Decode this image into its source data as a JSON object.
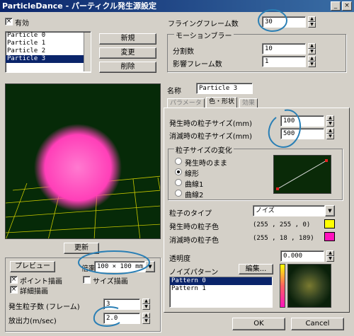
{
  "window": {
    "title": "ParticleDance - パーティクル発生源設定",
    "close_glyph": "×",
    "min_glyph": "_"
  },
  "enable_label": "有効",
  "particles": [
    "Particle 0",
    "Particle 1",
    "Particle 2",
    "Particle 3"
  ],
  "selected_particle_index": 3,
  "buttons": {
    "new": "新規",
    "change": "変更",
    "delete": "削除",
    "update": "更新",
    "preview": "プレビュー",
    "edit": "編集...",
    "ok": "OK",
    "cancel": "Cancel"
  },
  "flying_frames": {
    "label": "フライングフレーム数",
    "value": "30"
  },
  "motion_blur": {
    "title": "モーションブラー",
    "divisions_label": "分割数",
    "divisions_value": "10",
    "affect_frames_label": "影響フレーム数",
    "affect_frames_value": "1"
  },
  "name": {
    "label": "名称",
    "value": "Particle 3"
  },
  "tabs": [
    "パラメータ",
    "色・形状",
    "効果"
  ],
  "active_tab": 1,
  "size_birth": {
    "label": "発生時の粒子サイズ(mm)",
    "value": "100"
  },
  "size_death": {
    "label": "消滅時の粒子サイズ(mm)",
    "value": "500"
  },
  "size_change": {
    "title": "粒子サイズの変化",
    "options": [
      "発生時のまま",
      "線形",
      "曲線1",
      "曲線2"
    ],
    "selected": 1
  },
  "particle_type": {
    "label": "粒子のタイプ",
    "value": "ノイズ"
  },
  "color_birth": {
    "label": "発生時の粒子色",
    "value": "(255 , 255 , 0)",
    "swatch": "#ffff00"
  },
  "color_death": {
    "label": "消滅時の粒子色",
    "value": "(255 , 18 , 189)",
    "swatch": "#ff12bd"
  },
  "opacity": {
    "label": "透明度",
    "value": "0.000"
  },
  "noise_pattern": {
    "label": "ノイズパターン",
    "items": [
      "Pattern 0",
      "Pattern 1"
    ],
    "selected": 0
  },
  "preview_opts": {
    "scale_label": "倍率",
    "scale_value": "100 × 100 mm",
    "point_draw": "ポイント描画",
    "size_draw": "サイズ描画",
    "detail_draw": "詳細描画"
  },
  "emission_count": {
    "label": "発生粒子数 (フレーム)",
    "value": "3"
  },
  "emission_force": {
    "label": "放出力(m/sec)",
    "value": "2.0"
  },
  "colors": {
    "particle": "#ff3fb8",
    "grid": "#c8c800",
    "annotation": "#2a7fb5"
  }
}
